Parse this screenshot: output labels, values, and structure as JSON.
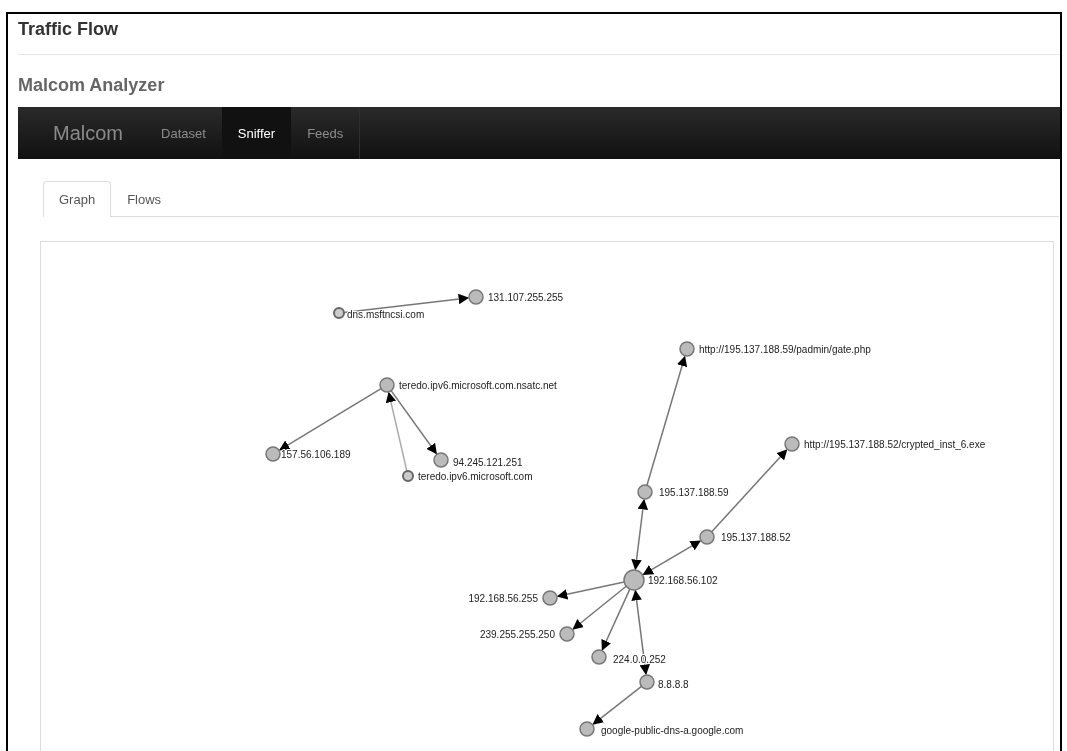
{
  "page_title": "Traffic Flow",
  "app_title": "Malcom Analyzer",
  "navbar": {
    "brand": "Malcom",
    "items": [
      {
        "label": "Dataset",
        "selected": false
      },
      {
        "label": "Sniffer",
        "selected": true
      },
      {
        "label": "Feeds",
        "selected": false
      }
    ]
  },
  "tabs": [
    {
      "label": "Graph",
      "selected": true
    },
    {
      "label": "Flows",
      "selected": false
    }
  ],
  "graph": {
    "nodes": [
      {
        "label": "dns.msftncsi.com",
        "kind": "small"
      },
      {
        "label": "131.107.255.255",
        "kind": "medium"
      },
      {
        "label": "teredo.ipv6.microsoft.com.nsatc.net",
        "kind": "medium"
      },
      {
        "label": "157.56.106.189",
        "kind": "medium"
      },
      {
        "label": "94.245.121.251",
        "kind": "medium"
      },
      {
        "label": "teredo.ipv6.microsoft.com",
        "kind": "small"
      },
      {
        "label": "http://195.137.188.59/padmin/gate.php",
        "kind": "medium"
      },
      {
        "label": "http://195.137.188.52/crypted_inst_6.exe",
        "kind": "medium"
      },
      {
        "label": "195.137.188.59",
        "kind": "medium"
      },
      {
        "label": "195.137.188.52",
        "kind": "medium"
      },
      {
        "label": "192.168.56.102",
        "kind": "large"
      },
      {
        "label": "192.168.56.255",
        "kind": "medium"
      },
      {
        "label": "239.255.255.250",
        "kind": "medium"
      },
      {
        "label": "224.0.0.252",
        "kind": "medium"
      },
      {
        "label": "8.8.8.8",
        "kind": "medium"
      },
      {
        "label": "google-public-dns-a.google.com",
        "kind": "medium"
      }
    ]
  }
}
